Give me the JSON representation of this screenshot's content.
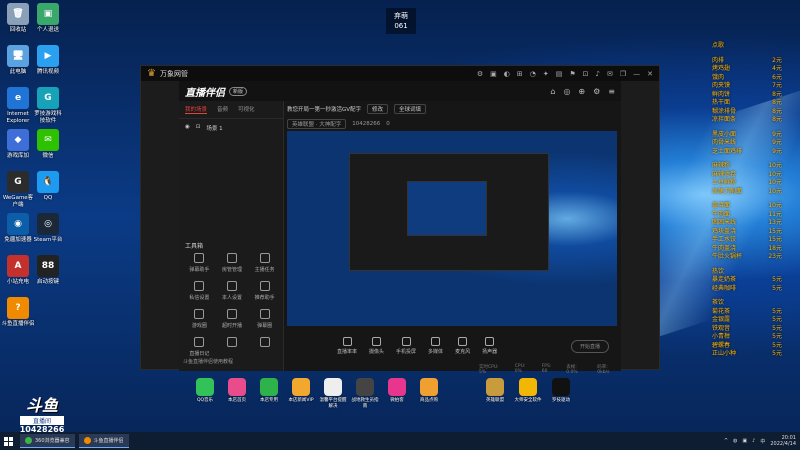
{
  "stream": {
    "line1": "弃萌",
    "line2": "061"
  },
  "desktop_icons": [
    {
      "id": "recycle-bin",
      "label": "回收站",
      "color": "#8aa0b8",
      "glyph": "🗑"
    },
    {
      "id": "personal-folder",
      "label": "个人退送",
      "color": "#3aa86b",
      "glyph": "▣"
    },
    {
      "id": "this-pc",
      "label": "此电脑",
      "color": "#5ba3e0",
      "glyph": "🖥"
    },
    {
      "id": "tencent-video",
      "label": "腾讯视频",
      "color": "#2aa0f0",
      "glyph": "▶"
    },
    {
      "id": "ie",
      "label": "Internet\nExplorer",
      "color": "#1f74d6",
      "glyph": "e"
    },
    {
      "id": "luoji-game",
      "label": "罗技游戏科\n技软件",
      "color": "#17a2b8",
      "glyph": "G"
    },
    {
      "id": "game-center",
      "label": "游戏库加",
      "color": "#3e6fd8",
      "glyph": "◆"
    },
    {
      "id": "wechat",
      "label": "微信",
      "color": "#2dc100",
      "glyph": "✉"
    },
    {
      "id": "wegame",
      "label": "WeGame客\n户端",
      "color": "#2c2c2c",
      "glyph": "G"
    },
    {
      "id": "qq",
      "label": "QQ",
      "color": "#1d9bf0",
      "glyph": "🐧"
    },
    {
      "id": "lianmeng",
      "label": "免疆加速器",
      "color": "#0c5ea8",
      "glyph": "◉"
    },
    {
      "id": "steam",
      "label": "Steam平台",
      "color": "#1b2838",
      "glyph": "◎"
    },
    {
      "id": "asus",
      "label": "小站充电",
      "color": "#c4302b",
      "glyph": "A"
    },
    {
      "id": "obs-key",
      "label": "启动按键",
      "color": "#222",
      "glyph": "88"
    },
    {
      "id": "douyu-helper",
      "label": "斗鱼直播伴侣",
      "color": "#f08a00",
      "glyph": "?"
    }
  ],
  "app_window": {
    "title": "万象网管",
    "logo_glyph": "♛",
    "tool_icons": [
      "⚙",
      "▣",
      "◐",
      "⊞",
      "◔",
      "✦",
      "▤",
      "⚑",
      "⊡",
      "♪",
      "✉",
      "❐",
      "—",
      "✕"
    ]
  },
  "stream_app": {
    "brand": "直播伴侣",
    "brand_badge": "新版",
    "header_icons": [
      "⌂",
      "◎",
      "⊕",
      "⚙",
      "≡"
    ],
    "left_tabs": [
      "我的场景",
      "音频",
      "可视化"
    ],
    "scene": {
      "eye": "◉",
      "lock": "⊡",
      "label": "场景 1"
    },
    "tools_title": "工具箱",
    "tools": [
      {
        "label": "弹幕助手"
      },
      {
        "label": "房管管理"
      },
      {
        "label": "主播任务"
      },
      {
        "label": "私信设置"
      },
      {
        "label": "本人设置"
      },
      {
        "label": "推荐助手"
      },
      {
        "label": "游戏圈"
      },
      {
        "label": "超时开播"
      },
      {
        "label": "弹幕圈"
      },
      {
        "label": "直播日记"
      },
      {
        "label": ""
      },
      {
        "label": ""
      }
    ],
    "left_bottom": "斗鱼直播伴侣使用教程",
    "room_title": "教您开局一第一秒激活GV配字",
    "room_tag": "修改",
    "room_category": "全球词填",
    "room_label2": "英雄联盟 · 大神配字",
    "room_id": "10428266",
    "room_fans": "0",
    "controls": [
      {
        "label": "直播率率"
      },
      {
        "label": "摄像头"
      },
      {
        "label": "手机投屏"
      },
      {
        "label": "多媒体"
      },
      {
        "label": "麦克风"
      },
      {
        "label": "扬声器"
      }
    ],
    "start_label": "开始直播",
    "status": [
      "实时CPU: 5%",
      "CPU: 0%",
      "FPS: 60",
      "丢帧: 0.0%",
      "码率: 0kb/s"
    ]
  },
  "price_list": {
    "title": "点歌",
    "groups": [
      {
        "head": "",
        "rows": [
          [
            "肉排",
            "2元"
          ],
          [
            "烤鸡翅",
            "4元"
          ],
          [
            "饿肉",
            "6元"
          ],
          [
            "肉夹馍",
            "7元"
          ],
          [
            "鲜肉饼",
            "8元"
          ],
          [
            "热干面",
            "8元"
          ],
          [
            "糊涂排骨",
            "8元"
          ],
          [
            "凉拌面条",
            "8元"
          ]
        ]
      },
      {
        "head": "",
        "rows": [
          [
            "黑皮小面",
            "9元"
          ],
          [
            "肉骨米线",
            "9元"
          ],
          [
            "芝士面鸡排",
            "9元"
          ]
        ]
      },
      {
        "head": "",
        "rows": [
          [
            "麻辣粉",
            "10元"
          ],
          [
            "麻辣烫卷",
            "10元"
          ],
          [
            "土豆鲜粉",
            "10元"
          ],
          [
            "凤尾刀削面",
            "10元"
          ]
        ]
      },
      {
        "head": "",
        "rows": [
          [
            "盖浇面",
            "10元"
          ],
          [
            "牛肉面",
            "11元"
          ],
          [
            "困困米线",
            "13元"
          ],
          [
            "鸡块盖浇",
            "15元"
          ],
          [
            "手工水饺",
            "15元"
          ],
          [
            "牛肉盖浇",
            "18元"
          ],
          [
            "牛肚火锅杯",
            "23元"
          ]
        ]
      },
      {
        "head": "热饮",
        "rows": [
          [
            "暴走奶茶",
            "5元"
          ],
          [
            "经典咖啡",
            "5元"
          ]
        ]
      },
      {
        "head": "茶饮",
        "rows": [
          [
            "菊花茶",
            "5元"
          ],
          [
            "金银露",
            "5元"
          ],
          [
            "铁观音",
            "5元"
          ],
          [
            "小青柑",
            "5元"
          ],
          [
            "碧螺春",
            "5元"
          ],
          [
            "正山小种",
            "5元"
          ]
        ]
      }
    ]
  },
  "douyu": {
    "mark": "斗鱼",
    "sub": "直播间",
    "room": "10428266"
  },
  "dock": [
    {
      "label": "QQ音乐",
      "color": "#33c25a"
    },
    {
      "label": "本店首页",
      "color": "#e94c8b"
    },
    {
      "label": "本店专用",
      "color": "#2db34a"
    },
    {
      "label": "本店新闻VIP",
      "color": "#f2a72e"
    },
    {
      "label": "温馨平台提醒\n解决",
      "color": "#eeeeee"
    },
    {
      "label": "战地救生员指\n南",
      "color": "#444444"
    },
    {
      "label": "微拍客",
      "color": "#e8368f"
    },
    {
      "label": "商品点购",
      "color": "#f0a030"
    },
    {
      "label": "英雄联盟",
      "color": "#c89b3c"
    },
    {
      "label": "大师安全软件",
      "color": "#f2b705"
    },
    {
      "label": "罗技驱动",
      "color": "#111111"
    }
  ],
  "taskbar": {
    "items": [
      {
        "label": "360浏览器兼容",
        "color": "#3bb54a"
      },
      {
        "label": "斗鱼直播伴侣",
        "color": "#f08a00"
      }
    ],
    "tray_icons": [
      "^",
      "◍",
      "▣",
      "♪",
      "中"
    ],
    "time": "20:01",
    "date": "2022/4/14"
  }
}
